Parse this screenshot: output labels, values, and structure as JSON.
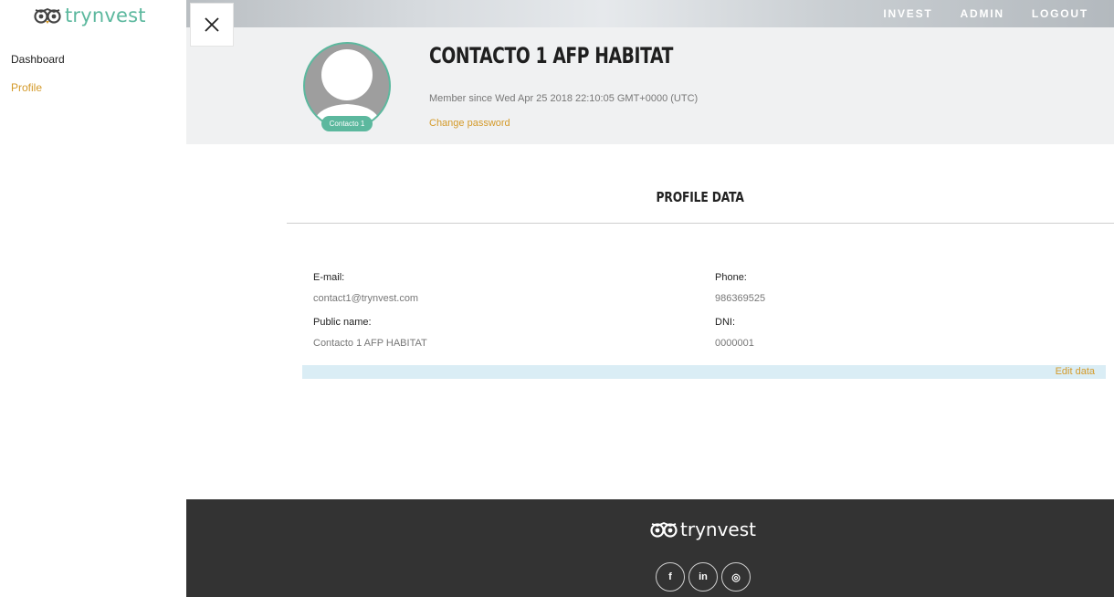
{
  "brand": {
    "name": "trynvest",
    "color": "#5cb89e",
    "accent": "#d49a2a"
  },
  "sidebar": {
    "items": [
      {
        "label": "Dashboard",
        "active": false
      },
      {
        "label": "Profile",
        "active": true
      }
    ]
  },
  "topnav": {
    "items": [
      "INVEST",
      "ADMIN",
      "LOGOUT"
    ]
  },
  "profile": {
    "name": "CONTACTO 1 AFP HABITAT",
    "avatar_badge": "Contacto 1",
    "member_since": "Member since Wed Apr 25 2018 22:10:05 GMT+0000 (UTC)",
    "change_password": "Change password"
  },
  "profile_data": {
    "title": "PROFILE DATA",
    "email_label": "E-mail:",
    "email_value": "contact1@trynvest.com",
    "phone_label": "Phone:",
    "phone_value": "986369525",
    "public_name_label": "Public name:",
    "public_name_value": "Contacto 1 AFP HABITAT",
    "dni_label": "DNI:",
    "dni_value": "0000001",
    "edit_label": "Edit data"
  },
  "footer": {
    "brand": "trynvest",
    "social": [
      {
        "icon": "facebook-icon",
        "glyph": "f"
      },
      {
        "icon": "linkedin-icon",
        "glyph": "in"
      },
      {
        "icon": "instagram-icon",
        "glyph": "◎"
      }
    ]
  }
}
